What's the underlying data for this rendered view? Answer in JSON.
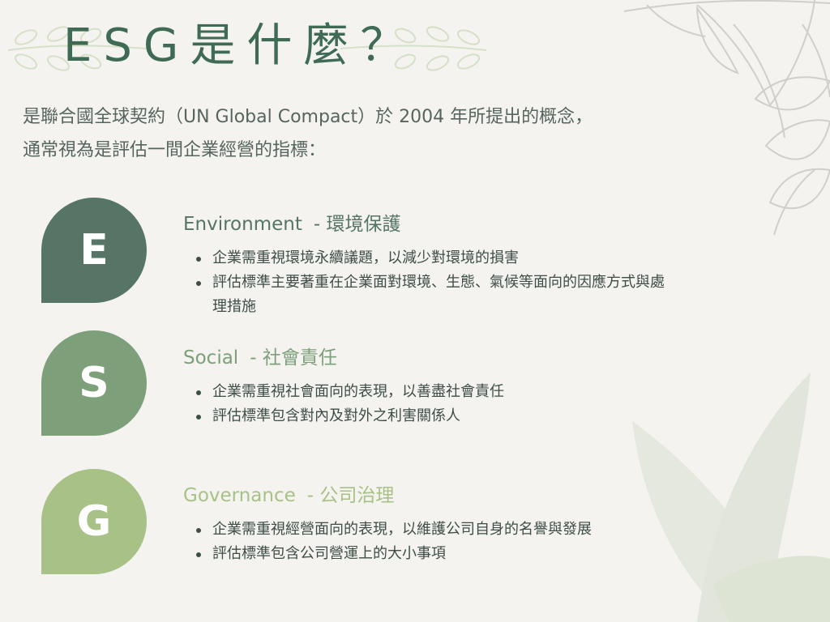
{
  "title": "ESG是什麼？",
  "intro": {
    "line1": "是聯合國全球契約（UN Global Compact）於 2004 年所提出的概念，",
    "line2": "通常視為是評估一間企業經營的指標："
  },
  "colors": {
    "environment": "#567566",
    "social": "#7d9f7a",
    "governance": "#a8c186",
    "title": "#3f6b55"
  },
  "icons": [
    "leaf-wreath-left-icon",
    "leaf-wreath-right-icon",
    "leaf-branch-icon",
    "leaves-bottom-right-icon"
  ],
  "sections": [
    {
      "letter": "E",
      "name": "Environment",
      "subtitle": "- 環境保護",
      "bullets": [
        "企業需重視環境永續議題，以減少對環境的損害",
        "評估標準主要著重在企業面對環境、生態、氣候等面向的因應方式與處理措施"
      ]
    },
    {
      "letter": "S",
      "name": "Social",
      "subtitle": "- 社會責任",
      "bullets": [
        "企業需重視社會面向的表現，以善盡社會責任",
        "評估標準包含對內及對外之利害關係人"
      ]
    },
    {
      "letter": "G",
      "name": "Governance",
      "subtitle": "- 公司治理",
      "bullets": [
        "企業需重視經營面向的表現，以維護公司自身的名譽與發展",
        "評估標準包含公司營運上的大小事項"
      ]
    }
  ]
}
